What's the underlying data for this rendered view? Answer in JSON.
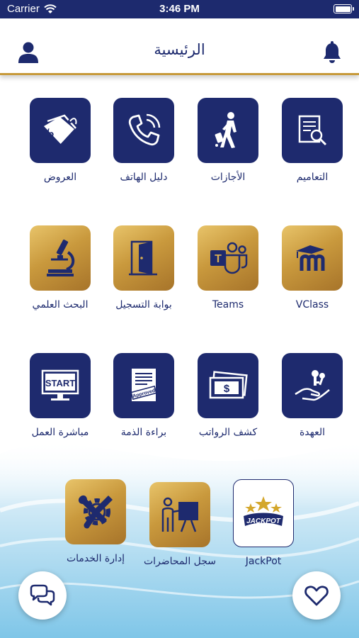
{
  "status_bar": {
    "carrier": "Carrier",
    "time": "3:46 PM"
  },
  "header": {
    "title": "الرئيسية"
  },
  "grid": {
    "items": [
      {
        "label": "التعاميم",
        "icon": "document-search-icon",
        "style": "navy"
      },
      {
        "label": "الأجازات",
        "icon": "traveler-icon",
        "style": "navy"
      },
      {
        "label": "دليل الهاتف",
        "icon": "phone-icon",
        "style": "navy"
      },
      {
        "label": "العروض",
        "icon": "discount-tag-icon",
        "style": "navy"
      },
      {
        "label": "VClass",
        "icon": "moodle-icon",
        "style": "gold"
      },
      {
        "label": "Teams",
        "icon": "teams-icon",
        "style": "gold"
      },
      {
        "label": "بوابة التسجيل",
        "icon": "door-icon",
        "style": "gold"
      },
      {
        "label": "البحث العلمي",
        "icon": "microscope-icon",
        "style": "gold"
      },
      {
        "label": "العهدة",
        "icon": "keys-hand-icon",
        "style": "navy"
      },
      {
        "label": "كشف الرواتب",
        "icon": "money-bill-icon",
        "style": "navy"
      },
      {
        "label": "براءة الذمة",
        "icon": "approved-document-icon",
        "style": "navy"
      },
      {
        "label": "مباشرة العمل",
        "icon": "start-monitor-icon",
        "style": "navy"
      },
      {
        "label": "JackPot",
        "icon": "jackpot-logo",
        "style": "white",
        "logo_text": "JACKPOT"
      },
      {
        "label": "سجل المحاضرات",
        "icon": "lecturer-board-icon",
        "style": "gold"
      },
      {
        "label": "إدارة الخدمات",
        "icon": "tools-gear-icon",
        "style": "gold"
      }
    ]
  },
  "colors": {
    "navy": "#1e2a6e",
    "gold": "#c9993d",
    "accent_line": "#c79a3b"
  }
}
